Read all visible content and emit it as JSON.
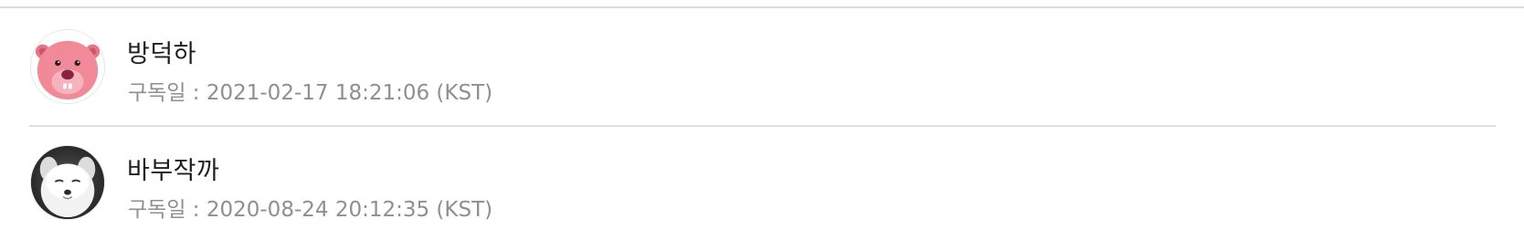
{
  "subscribers": [
    {
      "name": "방덕하",
      "subscribed_label": "구독일 : 2021-02-17 18:21:06 (KST)",
      "avatar": "pink-beaver-avatar"
    },
    {
      "name": "바부작까",
      "subscribed_label": "구독일 : 2020-08-24 20:12:35 (KST)",
      "avatar": "white-dog-avatar"
    }
  ],
  "colors": {
    "name_text": "#1e1e1e",
    "meta_text": "#8e8e93",
    "divider": "#dedede",
    "beaver_pink": "#f08a98"
  }
}
